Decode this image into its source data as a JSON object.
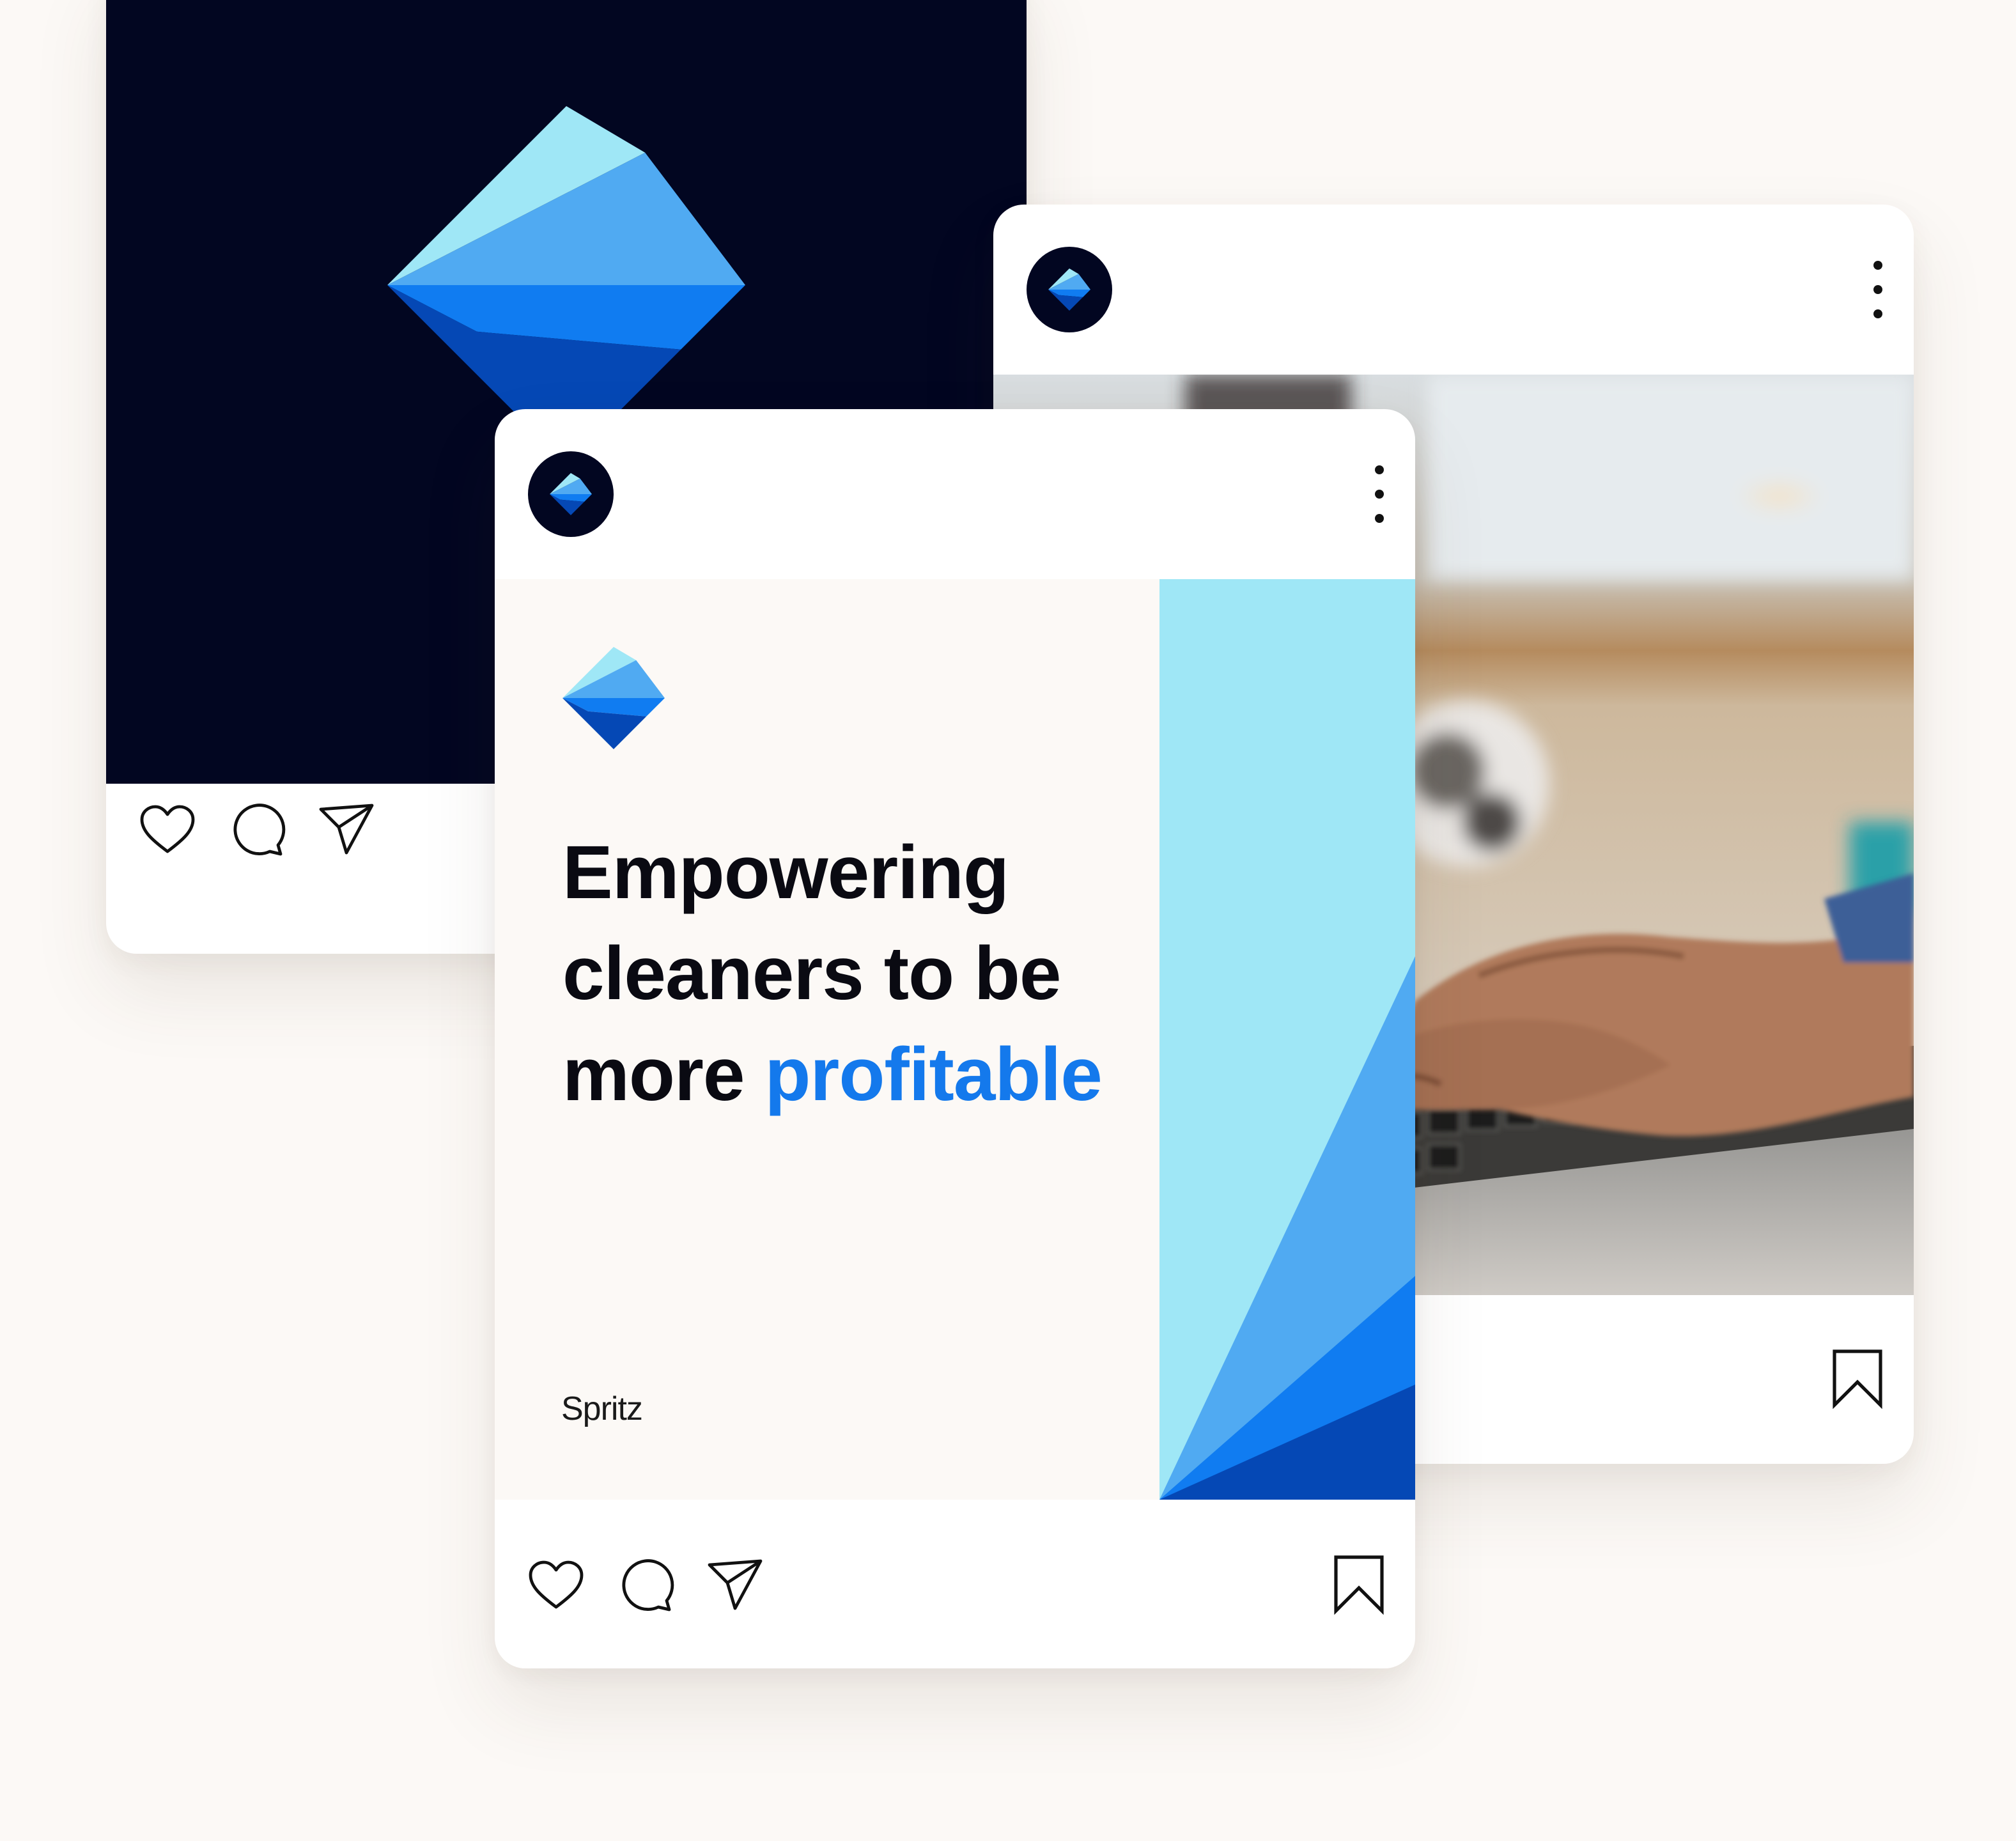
{
  "posts": [
    {
      "id_label": "dark-logo-post",
      "media_background": "#020621",
      "icons": [
        "heart-icon",
        "comment-icon",
        "send-icon"
      ]
    },
    {
      "id_label": "photo-post",
      "photo_subject": "hands typing on laptop keyboard",
      "icons": [
        "more-icon",
        "bookmark-icon"
      ]
    },
    {
      "id_label": "headline-post",
      "headline": {
        "line1": "Empowering",
        "line2": "cleaners to be",
        "line3_prefix": "more ",
        "line3_accent": "profitable"
      },
      "brand_name": "Spritz",
      "icons": [
        "heart-icon",
        "comment-icon",
        "send-icon",
        "bookmark-icon",
        "more-icon"
      ]
    }
  ],
  "colors": {
    "page_background": "#fcf9f6",
    "navy": "#020621",
    "sky_light": "#9fe7f6",
    "sky_mid": "#50aaf2",
    "blue": "#107cf1",
    "blue_dark": "#0548b5",
    "accent_text": "#1479ec"
  }
}
